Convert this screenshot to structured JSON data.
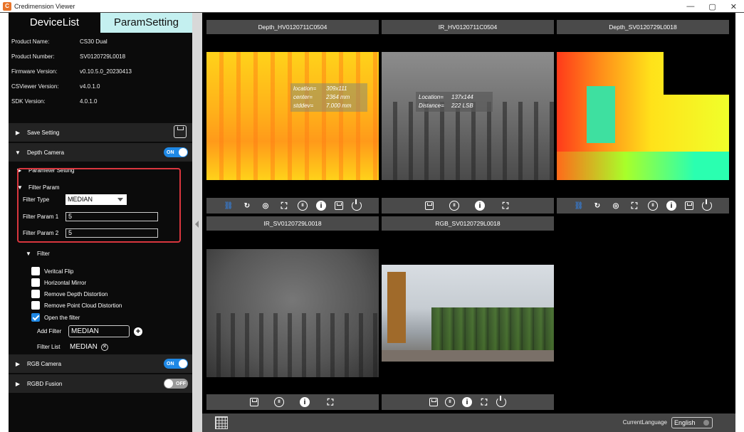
{
  "window": {
    "title": "Credimension Viewer",
    "minimize": "—",
    "restore": "▢",
    "close": "✕"
  },
  "tabs": {
    "device_list": "DeviceList",
    "param_setting": "ParamSetting"
  },
  "device_info": [
    {
      "label": "Product Name:",
      "value": "CS30 Dual"
    },
    {
      "label": "Product Number:",
      "value": "SV0120729L0018"
    },
    {
      "label": "Firmware Version:",
      "value": "v0.10.5.0_20230413"
    },
    {
      "label": "CSViewer Version:",
      "value": "v4.0.1.0"
    },
    {
      "label": "SDK Version:",
      "value": "4.0.1.0"
    }
  ],
  "sections": {
    "save_setting": "Save Setting",
    "depth_camera": "Depth Camera",
    "depth_toggle": "ON",
    "parameter_setting": "Parameter Setting",
    "filter_param": "Filter Param",
    "filter": "Filter",
    "rgb_camera": "RGB Camera",
    "rgb_toggle": "ON",
    "rgbd_fusion": "RGBD Fusion",
    "rgbd_toggle": "OFF"
  },
  "filter_param": {
    "type_label": "Filter Type",
    "type_value": "MEDIAN",
    "param1_label": "Filter Param 1",
    "param1_value": "5",
    "param2_label": "Filter Param 2",
    "param2_value": "5"
  },
  "filter": {
    "options": [
      {
        "label": "Veritcal Flip",
        "checked": false
      },
      {
        "label": "Horizontal Mirror",
        "checked": false
      },
      {
        "label": "Remove Depth Distortion",
        "checked": false
      },
      {
        "label": "Remove Point Cloud Distortion",
        "checked": false
      },
      {
        "label": "Open the filter",
        "checked": true
      }
    ],
    "add_filter_label": "Add Filter",
    "add_filter_value": "MEDIAN",
    "filter_list_label": "Filter List",
    "filter_list_value": "MEDIAN"
  },
  "views": {
    "depth_hv": "Depth_HV0120711C0504",
    "ir_hv": "IR_HV0120711C0504",
    "depth_sv": "Depth_SV0120729L0018",
    "ir_sv": "IR_SV0120729L0018",
    "rgb_sv": "RGB_SV0120729L0018"
  },
  "depth_overlay": {
    "location_label": "location=",
    "location_value": "309x111",
    "center_label": "center=",
    "center_value": "2364 mm",
    "stddev_label": "stddev=",
    "stddev_value": "7.000 mm"
  },
  "ir_overlay": {
    "location_label": "Location=",
    "location_value": "137x144",
    "distance_label": "Distance=",
    "distance_value": "222 LSB"
  },
  "bottom": {
    "language_label": "CurrentLanguage",
    "language_value": "English"
  },
  "colors": {
    "accent": "#1e88e5",
    "tab_active": "#c4f0f0",
    "highlight_box": "#d9363e"
  }
}
